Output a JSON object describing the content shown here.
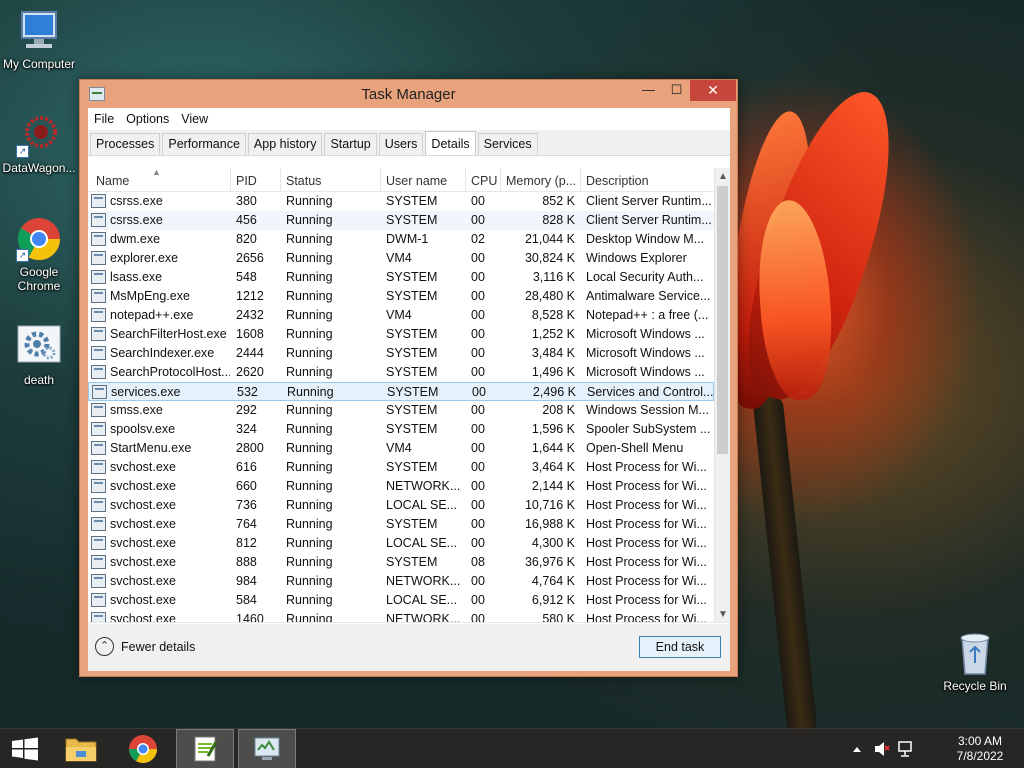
{
  "desktop": {
    "icons": [
      {
        "label": "My Computer"
      },
      {
        "label": "DataWagon..."
      },
      {
        "label": "Google Chrome"
      },
      {
        "label": "death"
      },
      {
        "label": "Recycle Bin"
      }
    ]
  },
  "window": {
    "title": "Task Manager",
    "buttons": {
      "minimize": "—",
      "maximize": "☐",
      "close": "✕"
    },
    "menu": [
      "File",
      "Options",
      "View"
    ],
    "tabs": [
      "Processes",
      "Performance",
      "App history",
      "Startup",
      "Users",
      "Details",
      "Services"
    ],
    "active_tab": "Details",
    "columns": [
      "Name",
      "PID",
      "Status",
      "User name",
      "CPU",
      "Memory (p...",
      "Description"
    ],
    "rows": [
      {
        "name": "csrss.exe",
        "pid": "380",
        "status": "Running",
        "user": "SYSTEM",
        "cpu": "00",
        "mem": "852 K",
        "desc": "Client Server Runtim..."
      },
      {
        "name": "csrss.exe",
        "pid": "456",
        "status": "Running",
        "user": "SYSTEM",
        "cpu": "00",
        "mem": "828 K",
        "desc": "Client Server Runtim..."
      },
      {
        "name": "dwm.exe",
        "pid": "820",
        "status": "Running",
        "user": "DWM-1",
        "cpu": "02",
        "mem": "21,044 K",
        "desc": "Desktop Window M..."
      },
      {
        "name": "explorer.exe",
        "pid": "2656",
        "status": "Running",
        "user": "VM4",
        "cpu": "00",
        "mem": "30,824 K",
        "desc": "Windows Explorer"
      },
      {
        "name": "lsass.exe",
        "pid": "548",
        "status": "Running",
        "user": "SYSTEM",
        "cpu": "00",
        "mem": "3,116 K",
        "desc": "Local Security Auth..."
      },
      {
        "name": "MsMpEng.exe",
        "pid": "1212",
        "status": "Running",
        "user": "SYSTEM",
        "cpu": "00",
        "mem": "28,480 K",
        "desc": "Antimalware Service..."
      },
      {
        "name": "notepad++.exe",
        "pid": "2432",
        "status": "Running",
        "user": "VM4",
        "cpu": "00",
        "mem": "8,528 K",
        "desc": "Notepad++ : a free (..."
      },
      {
        "name": "SearchFilterHost.exe",
        "pid": "1608",
        "status": "Running",
        "user": "SYSTEM",
        "cpu": "00",
        "mem": "1,252 K",
        "desc": "Microsoft Windows ..."
      },
      {
        "name": "SearchIndexer.exe",
        "pid": "2444",
        "status": "Running",
        "user": "SYSTEM",
        "cpu": "00",
        "mem": "3,484 K",
        "desc": "Microsoft Windows ..."
      },
      {
        "name": "SearchProtocolHost....",
        "pid": "2620",
        "status": "Running",
        "user": "SYSTEM",
        "cpu": "00",
        "mem": "1,496 K",
        "desc": "Microsoft Windows ..."
      },
      {
        "name": "services.exe",
        "pid": "532",
        "status": "Running",
        "user": "SYSTEM",
        "cpu": "00",
        "mem": "2,496 K",
        "desc": "Services and Control..."
      },
      {
        "name": "smss.exe",
        "pid": "292",
        "status": "Running",
        "user": "SYSTEM",
        "cpu": "00",
        "mem": "208 K",
        "desc": "Windows Session M..."
      },
      {
        "name": "spoolsv.exe",
        "pid": "324",
        "status": "Running",
        "user": "SYSTEM",
        "cpu": "00",
        "mem": "1,596 K",
        "desc": "Spooler SubSystem ..."
      },
      {
        "name": "StartMenu.exe",
        "pid": "2800",
        "status": "Running",
        "user": "VM4",
        "cpu": "00",
        "mem": "1,644 K",
        "desc": "Open-Shell Menu"
      },
      {
        "name": "svchost.exe",
        "pid": "616",
        "status": "Running",
        "user": "SYSTEM",
        "cpu": "00",
        "mem": "3,464 K",
        "desc": "Host Process for Wi..."
      },
      {
        "name": "svchost.exe",
        "pid": "660",
        "status": "Running",
        "user": "NETWORK...",
        "cpu": "00",
        "mem": "2,144 K",
        "desc": "Host Process for Wi..."
      },
      {
        "name": "svchost.exe",
        "pid": "736",
        "status": "Running",
        "user": "LOCAL SE...",
        "cpu": "00",
        "mem": "10,716 K",
        "desc": "Host Process for Wi..."
      },
      {
        "name": "svchost.exe",
        "pid": "764",
        "status": "Running",
        "user": "SYSTEM",
        "cpu": "00",
        "mem": "16,988 K",
        "desc": "Host Process for Wi..."
      },
      {
        "name": "svchost.exe",
        "pid": "812",
        "status": "Running",
        "user": "LOCAL SE...",
        "cpu": "00",
        "mem": "4,300 K",
        "desc": "Host Process for Wi..."
      },
      {
        "name": "svchost.exe",
        "pid": "888",
        "status": "Running",
        "user": "SYSTEM",
        "cpu": "08",
        "mem": "36,976 K",
        "desc": "Host Process for Wi..."
      },
      {
        "name": "svchost.exe",
        "pid": "984",
        "status": "Running",
        "user": "NETWORK...",
        "cpu": "00",
        "mem": "4,764 K",
        "desc": "Host Process for Wi..."
      },
      {
        "name": "svchost.exe",
        "pid": "584",
        "status": "Running",
        "user": "LOCAL SE...",
        "cpu": "00",
        "mem": "6,912 K",
        "desc": "Host Process for Wi..."
      },
      {
        "name": "svchost.exe",
        "pid": "1460",
        "status": "Running",
        "user": "NETWORK...",
        "cpu": "00",
        "mem": "580 K",
        "desc": "Host Process for Wi..."
      }
    ],
    "selected_row": 10,
    "hover_row": 1,
    "footer": {
      "fewer_details": "Fewer details",
      "end_task": "End task"
    }
  },
  "taskbar": {
    "clock_time": "3:00 AM",
    "clock_date": "7/8/2022"
  },
  "colors": {
    "title_bar": "#e8a27c",
    "close_button": "#c7453a",
    "selection": "#e5f1fb"
  }
}
